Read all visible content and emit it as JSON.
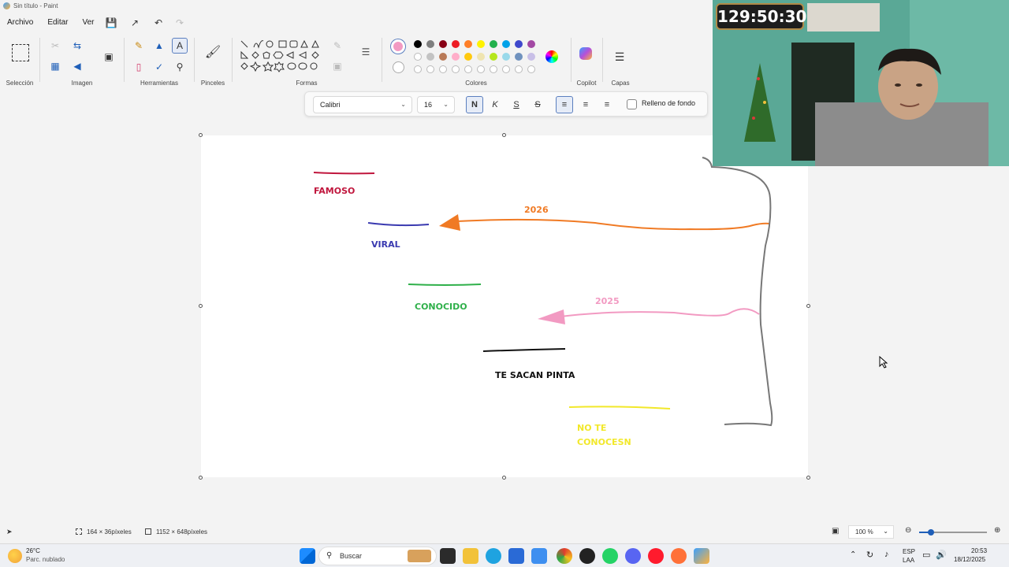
{
  "window": {
    "title": "Sin título - Paint"
  },
  "menu": {
    "items": [
      "Archivo",
      "Editar",
      "Ver"
    ]
  },
  "ribbon": {
    "groups": {
      "selection": "Selección",
      "image": "Imagen",
      "tools": "Herramientas",
      "brushes": "Pinceles",
      "shapes": "Formas",
      "colors": "Colores",
      "copilot": "Copilot",
      "layers": "Capas"
    },
    "active_color": "#f29ac2"
  },
  "text_toolbar": {
    "font": "Calibri",
    "size": "16",
    "bold": "N",
    "italic": "K",
    "underline": "S",
    "strike": "S",
    "fill_label": "Relleno de fondo"
  },
  "canvas_labels": {
    "famoso": "FAMOSO",
    "viral": "VIRAL",
    "conocido": "CONOCIDO",
    "te_sacan": "TE SACAN PINTA",
    "no_te": "NO TE",
    "conocesn": "CONOCESN",
    "year_2026": "2026",
    "year_2025": "2025"
  },
  "colors": {
    "famoso": "#c0163d",
    "viral": "#3a3ab0",
    "conocido": "#2fb04a",
    "te_sacan": "#111111",
    "no_te": "#f2e82a",
    "year_2026": "#f07a24",
    "year_2025": "#f29ac2",
    "bracket": "#777777"
  },
  "webcam": {
    "timer": "129:50:30"
  },
  "status": {
    "selection_size": "164 × 36píxeles",
    "canvas_size": "1152 × 648píxeles",
    "zoom": "100 %"
  },
  "taskbar": {
    "weather_temp": "26°C",
    "weather_desc": "Parc. nublado",
    "search": "Buscar",
    "lang_top": "ESP",
    "lang_bottom": "LAA",
    "time": "20:53",
    "date": "18/12/2025"
  }
}
